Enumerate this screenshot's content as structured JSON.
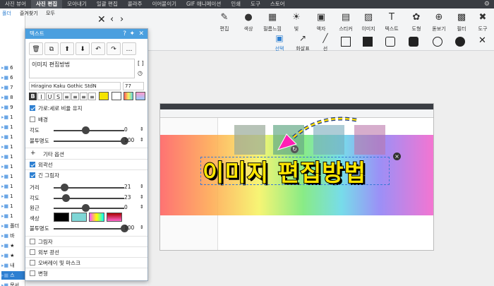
{
  "top_tabs": [
    "사진 뷰어",
    "사진 편집",
    "모아내기",
    "일괄 편집",
    "콜라주",
    "이어붙이기",
    "GIF 애니메이션",
    "인쇄",
    "도구",
    "스토어"
  ],
  "top_active": 1,
  "toolbar": {
    "tools": [
      "편집",
      "색상",
      "필름느낌",
      "빛",
      "액자",
      "스티커",
      "이미지",
      "텍스트",
      "도형",
      "돋보기",
      "필터",
      "도구"
    ],
    "select_label": "선택",
    "arrow_label": "화살표",
    "line_label": "선"
  },
  "sidebar": {
    "tab1": "폴더",
    "tab2": "즐겨찾기",
    "tab3": "모두",
    "items": [
      "6",
      "6",
      "7",
      "8",
      "9",
      "1",
      "1",
      "1",
      "1",
      "1",
      "1",
      "1",
      "1",
      "1",
      "1",
      "1",
      "폴더",
      "바",
      "★",
      "★",
      "내",
      "스",
      "문서",
      "김재",
      "폴더"
    ]
  },
  "panel": {
    "title": "텍스트",
    "text_value": "이미지 편집방법",
    "font_name": "Hiragino Kaku Gothic StdN",
    "font_size": "77",
    "ratio_label": "가로:세로 비율 유지",
    "bg_label": "배경",
    "angle_label": "각도",
    "angle_value": "0",
    "opacity_label": "불투명도",
    "opacity_value": "100",
    "more_label": "기타 옵션",
    "outline_label": "외곽선",
    "long_shadow_label": "긴 그림자",
    "distance_label": "거리",
    "distance_value": "21",
    "angle2_label": "각도",
    "angle2_value": "23",
    "perspective_label": "원근",
    "perspective_value": "0",
    "color_label": "색상",
    "opacity2_label": "불투명도",
    "opacity2_value": "100",
    "shadow_label": "그림자",
    "outer_glow_label": "외부 광선",
    "overlay_label": "오버레이 및 마스크",
    "transform_label": "변형"
  },
  "canvas": {
    "big_text": "이미지 편집방법"
  },
  "colors": {
    "panel_title_bg": "#4a9fdf",
    "accent": "#2d7fd1",
    "text_fill": "#ffe600"
  }
}
